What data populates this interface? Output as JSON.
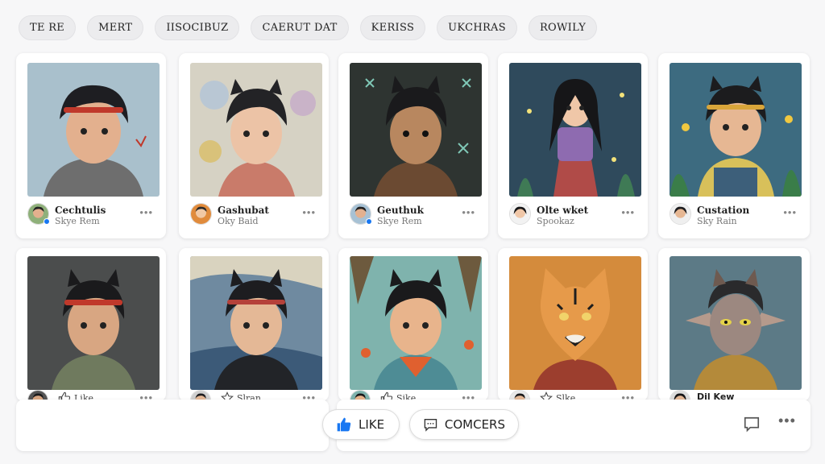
{
  "filters": [
    "TE RE",
    "MERT",
    "ІІЅОСІВUZ",
    "CAERUT DAT",
    "KERISS",
    "UKCHRAS",
    "ROWILY"
  ],
  "row1": [
    {
      "name": "Cechtulis",
      "sub": "Skye Rem",
      "verified": true
    },
    {
      "name": "Gashubat",
      "sub": "Oky Baid",
      "verified": false
    },
    {
      "name": "Geuthuk",
      "sub": "Skye Rem",
      "verified": true
    },
    {
      "name": "Olte wket",
      "sub": "Spookaz",
      "verified": false
    },
    {
      "name": "Custation",
      "sub": "Sky Rain",
      "verified": false
    }
  ],
  "row2": [
    {
      "action": "Like",
      "icon": "thumbs-up-icon"
    },
    {
      "action": "Slran",
      "icon": "star-icon"
    },
    {
      "action": "Sike",
      "icon": "thumbs-up-icon"
    },
    {
      "action": "Slke",
      "icon": "star-icon"
    },
    {
      "name": "Dil Kew"
    }
  ],
  "more_label": "•••",
  "bottom": {
    "like_label": "LIKE",
    "comments_label": "COMCERS",
    "more_label": "•••"
  },
  "colors": {
    "accent": "#1877f2",
    "card_bg": "#ffffff",
    "page_bg": "#f7f7f8"
  }
}
